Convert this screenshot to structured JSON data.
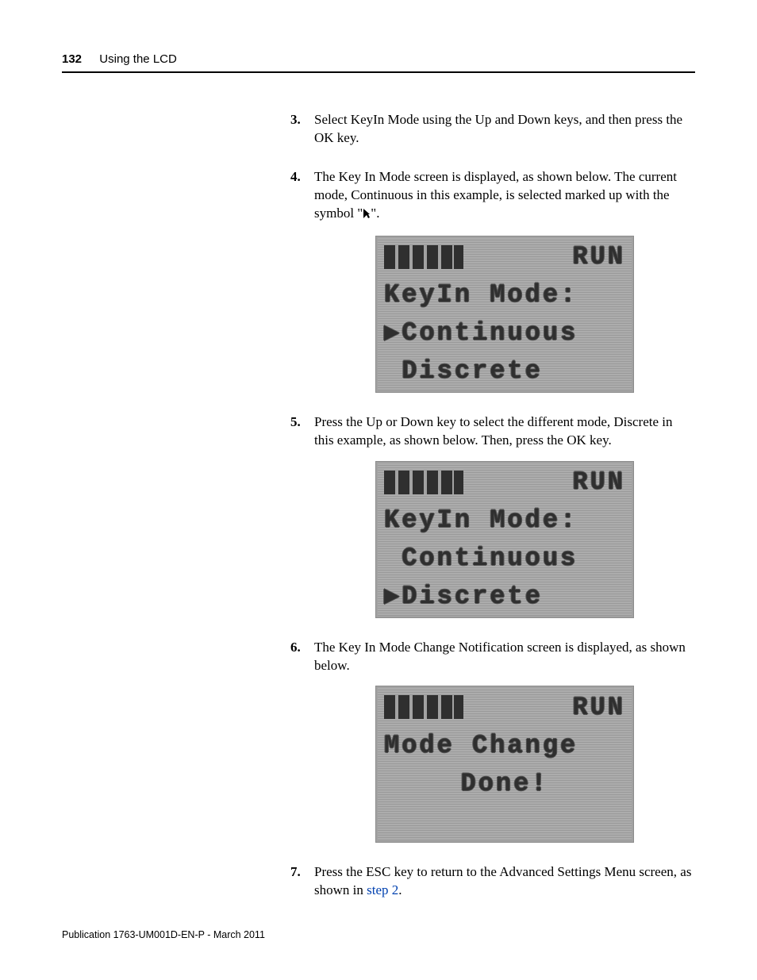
{
  "header": {
    "page_number": "132",
    "section_title": "Using the LCD"
  },
  "steps": [
    {
      "number": "3.",
      "text_parts": [
        "Select KeyIn Mode using the Up and Down keys, and then press the OK key."
      ]
    },
    {
      "number": "4.",
      "text_parts": [
        "The Key In Mode screen is displayed, as shown below. The current mode, Continuous in this example, is selected marked up with the symbol \"",
        "SYMBOL",
        "\"."
      ],
      "lcd": {
        "top_right": "RUN",
        "line2": "KeyIn Mode:",
        "line3": "▶Continuous",
        "line4": " Discrete"
      }
    },
    {
      "number": "5.",
      "text_parts": [
        "Press the Up or Down key to select the different mode, Discrete in this example, as shown below. Then, press the OK key."
      ],
      "lcd": {
        "top_right": "RUN",
        "line2": "KeyIn Mode:",
        "line3": " Continuous",
        "line4": "▶Discrete"
      }
    },
    {
      "number": "6.",
      "text_parts": [
        "The Key In Mode Change Notification screen is displayed, as shown below."
      ],
      "lcd": {
        "top_right": "RUN",
        "line2": "Mode Change",
        "line3_center": "Done!",
        "line4": ""
      }
    },
    {
      "number": "7.",
      "text_parts": [
        "Press the ESC key to return to the Advanced Settings Menu screen, as shown in ",
        "LINK",
        "."
      ],
      "link_text": "step 2"
    }
  ],
  "footer": {
    "publication": "Publication 1763-UM001D-EN-P - March 2011"
  }
}
